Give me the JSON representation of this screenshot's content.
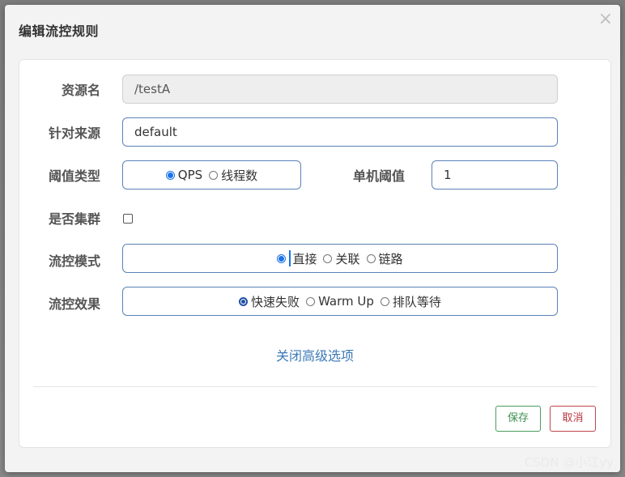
{
  "dialog": {
    "title": "编辑流控规则",
    "close_symbol": "×"
  },
  "form": {
    "resource": {
      "label": "资源名",
      "value": "/testA"
    },
    "source": {
      "label": "针对来源",
      "value": "default"
    },
    "threshold_type": {
      "label": "阈值类型",
      "options": [
        "QPS",
        "线程数"
      ],
      "selected": "QPS"
    },
    "single_threshold": {
      "label": "单机阈值",
      "value": "1"
    },
    "cluster": {
      "label": "是否集群",
      "checked": false
    },
    "flow_mode": {
      "label": "流控模式",
      "options": [
        "直接",
        "关联",
        "链路"
      ],
      "selected": "直接"
    },
    "flow_effect": {
      "label": "流控效果",
      "options": [
        "快速失败",
        "Warm Up",
        "排队等待"
      ],
      "selected": "快速失败"
    },
    "advanced_toggle": "关闭高级选项"
  },
  "footer": {
    "save_label": "保存",
    "cancel_label": "取消"
  },
  "watermark": "CSDN @小江yy",
  "colors": {
    "accent_blue": "#5b82b8",
    "link_blue": "#3b7ab8",
    "save_green": "#3d8f4d",
    "cancel_red": "#b8353d"
  }
}
